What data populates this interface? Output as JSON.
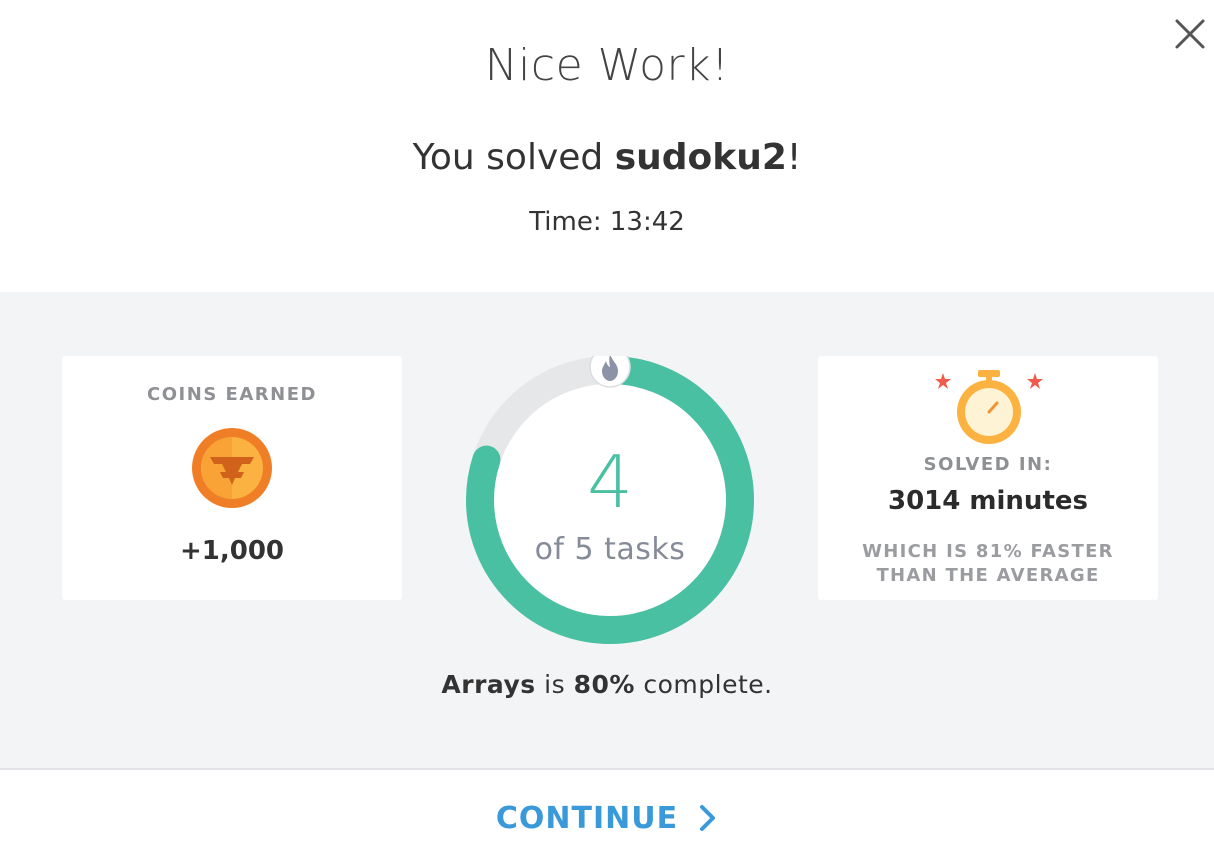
{
  "dialog": {
    "title": "Nice Work!",
    "solved_prefix": "You solved ",
    "puzzle_name": "sudoku2",
    "solved_suffix": "!",
    "time_label": "Time: ",
    "time_value": "13:42"
  },
  "coins": {
    "caption": "COINS EARNED",
    "value": "+1,000",
    "icon": "coin-icon"
  },
  "progress": {
    "completed": "4",
    "tasks_label": "of 5 tasks",
    "fraction": 0.8,
    "topic": "Arrays",
    "mid_text": " is ",
    "percent": "80%",
    "end_text": " complete.",
    "icon": "flame-icon",
    "color_done": "#4ac0a2",
    "color_remaining": "#e6e7e9"
  },
  "solved": {
    "caption": "SOLVED IN:",
    "value": "3014 minutes",
    "comparison_line1": "WHICH IS 81% FASTER",
    "comparison_line2": "THAN THE AVERAGE",
    "icon": "stopwatch-icon"
  },
  "footer": {
    "continue_label": "CONTINUE",
    "icon": "chevron-right-icon",
    "color": "#3a9ad9"
  },
  "close_icon": "close-icon"
}
